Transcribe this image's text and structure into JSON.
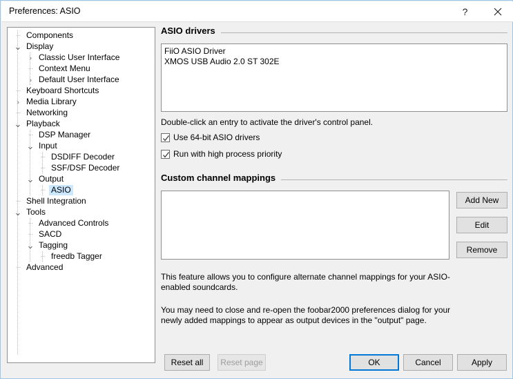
{
  "window": {
    "title": "Preferences: ASIO",
    "help_icon": "question-mark-icon",
    "close_icon": "close-icon"
  },
  "sidebar": {
    "items": [
      {
        "label": "Components",
        "indent": 1,
        "state": "leaf",
        "selected": false
      },
      {
        "label": "Display",
        "indent": 1,
        "state": "expanded",
        "selected": false
      },
      {
        "label": "Classic User Interface",
        "indent": 2,
        "state": "collapsed",
        "selected": false
      },
      {
        "label": "Context Menu",
        "indent": 2,
        "state": "leaf",
        "selected": false
      },
      {
        "label": "Default User Interface",
        "indent": 2,
        "state": "collapsed",
        "selected": false
      },
      {
        "label": "Keyboard Shortcuts",
        "indent": 1,
        "state": "leaf",
        "selected": false
      },
      {
        "label": "Media Library",
        "indent": 1,
        "state": "collapsed",
        "selected": false
      },
      {
        "label": "Networking",
        "indent": 1,
        "state": "leaf",
        "selected": false
      },
      {
        "label": "Playback",
        "indent": 1,
        "state": "expanded",
        "selected": false
      },
      {
        "label": "DSP Manager",
        "indent": 2,
        "state": "leaf",
        "selected": false
      },
      {
        "label": "Input",
        "indent": 2,
        "state": "expanded",
        "selected": false
      },
      {
        "label": "DSDIFF Decoder",
        "indent": 3,
        "state": "leaf",
        "selected": false
      },
      {
        "label": "SSF/DSF Decoder",
        "indent": 3,
        "state": "leaf",
        "selected": false
      },
      {
        "label": "Output",
        "indent": 2,
        "state": "expanded",
        "selected": false
      },
      {
        "label": "ASIO",
        "indent": 3,
        "state": "leaf",
        "selected": true
      },
      {
        "label": "Shell Integration",
        "indent": 1,
        "state": "leaf",
        "selected": false
      },
      {
        "label": "Tools",
        "indent": 1,
        "state": "expanded",
        "selected": false
      },
      {
        "label": "Advanced Controls",
        "indent": 2,
        "state": "leaf",
        "selected": false
      },
      {
        "label": "SACD",
        "indent": 2,
        "state": "leaf",
        "selected": false
      },
      {
        "label": "Tagging",
        "indent": 2,
        "state": "expanded",
        "selected": false
      },
      {
        "label": "freedb Tagger",
        "indent": 3,
        "state": "leaf",
        "selected": false
      },
      {
        "label": "Advanced",
        "indent": 1,
        "state": "leaf",
        "selected": false
      }
    ]
  },
  "drivers_group": {
    "heading": "ASIO drivers",
    "items": [
      "FiiO ASIO Driver",
      "XMOS USB Audio 2.0 ST 302E"
    ],
    "hint": "Double-click an entry to activate the driver's control panel.",
    "checkboxes": [
      {
        "label": "Use 64-bit ASIO drivers",
        "checked": true
      },
      {
        "label": "Run with high process priority",
        "checked": true
      }
    ]
  },
  "mappings_group": {
    "heading": "Custom channel mappings",
    "items": [],
    "buttons": [
      {
        "label": "Add New",
        "disabled": false
      },
      {
        "label": "Edit",
        "disabled": false
      },
      {
        "label": "Remove",
        "disabled": false
      }
    ],
    "paragraph1": "This feature allows you to configure alternate channel mappings for your ASIO-enabled soundcards.",
    "paragraph2": "You may need to close and re-open the foobar2000 preferences dialog for your newly added mappings to appear as output devices in the \"output\" page."
  },
  "footer": {
    "reset_all": "Reset all",
    "reset_page": "Reset page",
    "ok": "OK",
    "cancel": "Cancel",
    "apply": "Apply"
  },
  "colors": {
    "accent": "#0078d7",
    "selection": "#cce8ff",
    "dialog_bg": "#f0f0f0",
    "button_bg": "#e1e1e1"
  }
}
